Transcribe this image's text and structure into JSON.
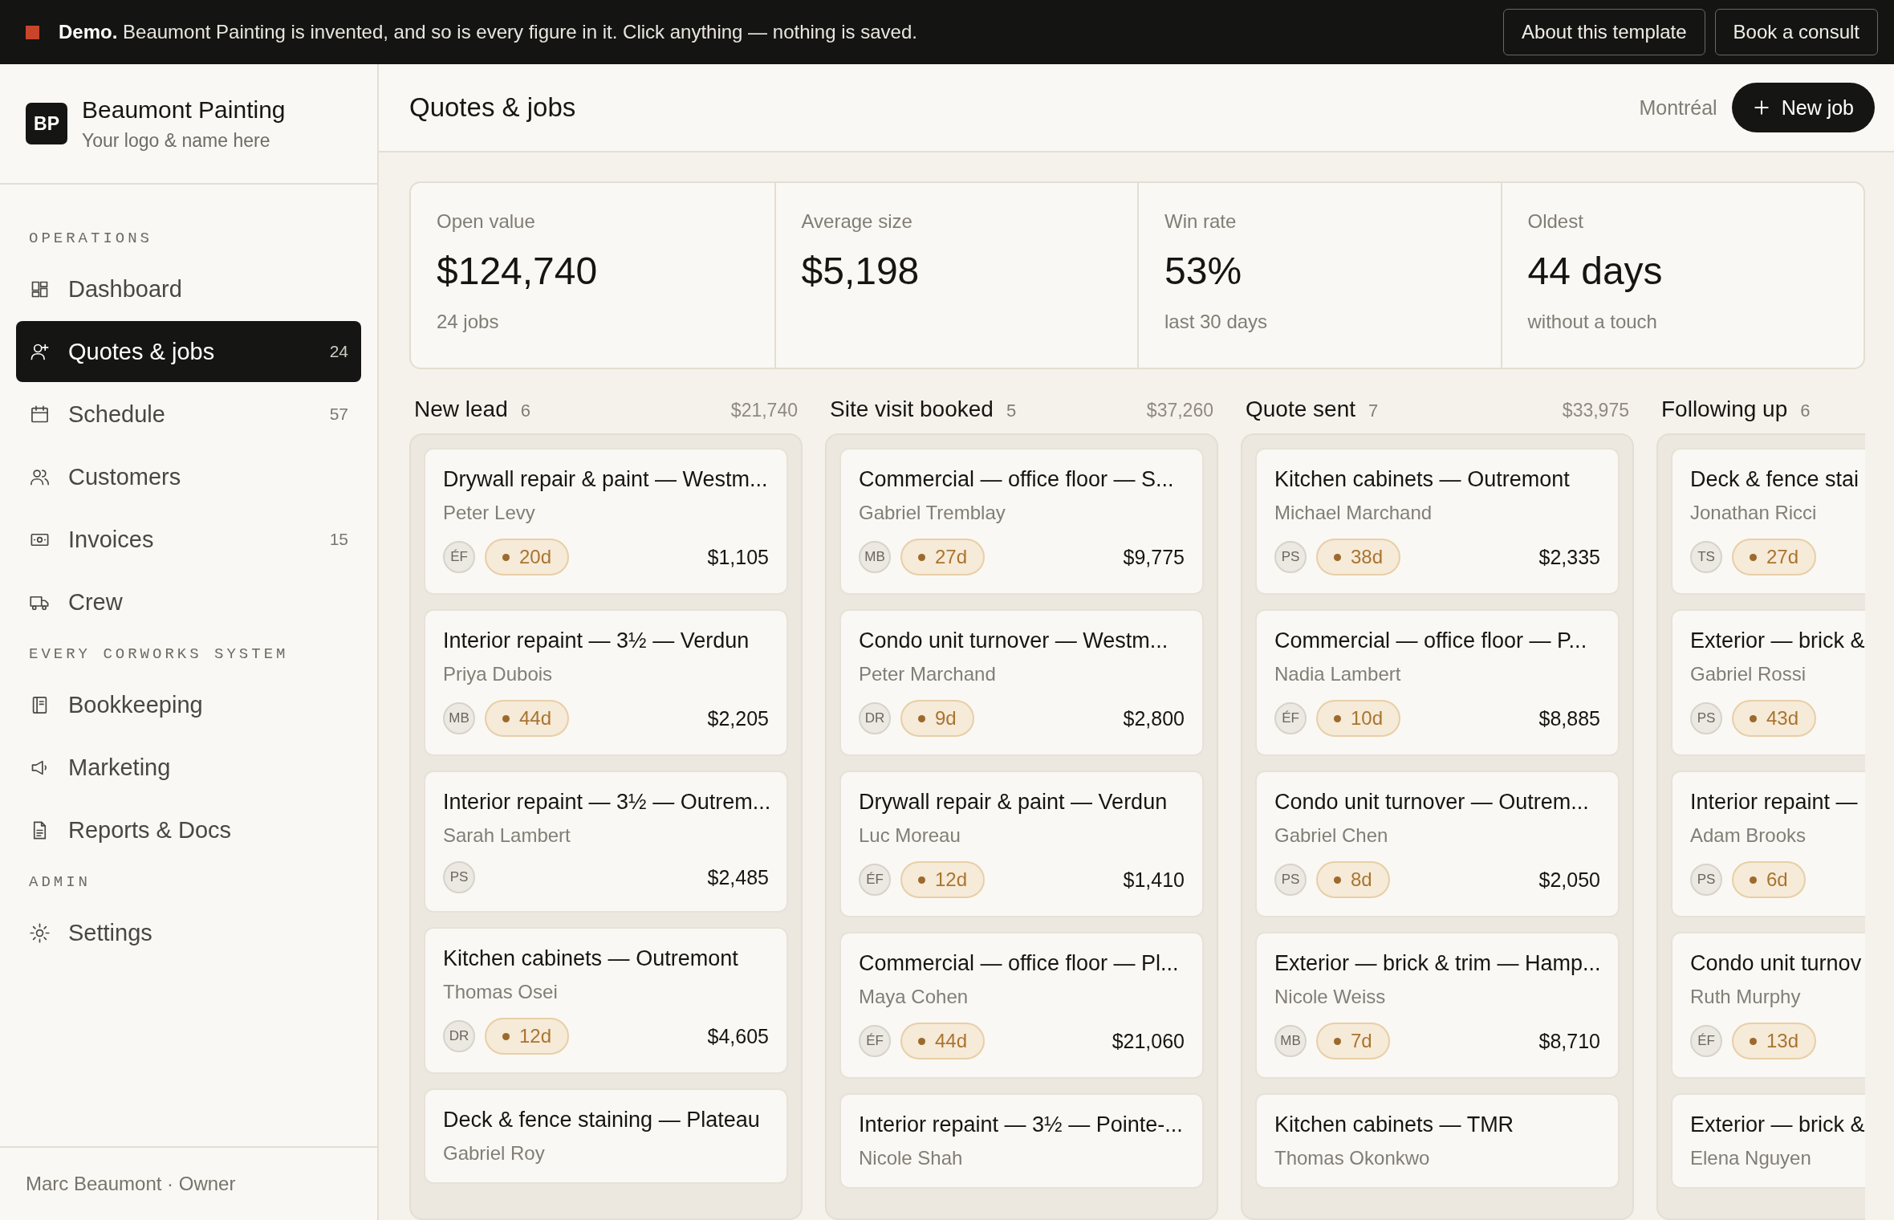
{
  "banner": {
    "text": "**Demo.** Beaumont Painting is invented, and so is every figure in it. Click anything — nothing is saved.",
    "buttons": [
      "About this template",
      "Book a consult"
    ]
  },
  "brand": {
    "initials": "BP",
    "name": "Beaumont Painting",
    "tagline": "Your logo & name here"
  },
  "nav": [
    {
      "heading": "OPERATIONS",
      "items": [
        {
          "label": "Dashboard",
          "selected": false
        },
        {
          "label": "Quotes & jobs",
          "count": "24",
          "selected": true
        },
        {
          "label": "Schedule",
          "count": "57",
          "selected": false
        },
        {
          "label": "Customers",
          "selected": false
        },
        {
          "label": "Invoices",
          "count": "15",
          "selected": false
        },
        {
          "label": "Crew",
          "selected": false
        }
      ]
    },
    {
      "heading": "EVERY CORWORKS SYSTEM",
      "items": [
        {
          "label": "Bookkeeping",
          "selected": false
        },
        {
          "label": "Marketing",
          "selected": false
        },
        {
          "label": "Reports & Docs",
          "selected": false
        }
      ]
    },
    {
      "heading": "ADMIN",
      "items": [
        {
          "label": "Settings",
          "selected": false
        }
      ]
    }
  ],
  "user": "Marc Beaumont · Owner",
  "header": {
    "title": "Quotes & jobs",
    "location": "Montréal",
    "new_button": "New job"
  },
  "stats": [
    {
      "label": "Open value",
      "value": "$124,740",
      "note": "24 jobs"
    },
    {
      "label": "Average size",
      "value": "$5,198"
    },
    {
      "label": "Win rate",
      "value": "53%",
      "note": "last 30 days"
    },
    {
      "label": "Oldest",
      "value": "44 days",
      "note": "without a touch"
    }
  ],
  "columns": [
    {
      "title": "New lead",
      "count": "6",
      "total": "$21,740",
      "cards": [
        {
          "title": "Drywall repair & paint — Westm...",
          "client": "Peter Levy",
          "initials": "ÉF",
          "age": "20d",
          "amount": "$1,105"
        },
        {
          "title": "Interior repaint — 3½ — Verdun",
          "client": "Priya Dubois",
          "initials": "MB",
          "age": "44d",
          "amount": "$2,205"
        },
        {
          "title": "Interior repaint — 3½ — Outrem...",
          "client": "Sarah Lambert",
          "initials": "PS",
          "amount": "$2,485"
        },
        {
          "title": "Kitchen cabinets — Outremont",
          "client": "Thomas Osei",
          "initials": "DR",
          "age": "12d",
          "amount": "$4,605"
        },
        {
          "title": "Deck & fence staining — Plateau",
          "client": "Gabriel Roy"
        }
      ]
    },
    {
      "title": "Site visit booked",
      "count": "5",
      "total": "$37,260",
      "cards": [
        {
          "title": "Commercial — office floor — S...",
          "client": "Gabriel Tremblay",
          "initials": "MB",
          "age": "27d",
          "amount": "$9,775"
        },
        {
          "title": "Condo unit turnover — Westm...",
          "client": "Peter Marchand",
          "initials": "DR",
          "age": "9d",
          "amount": "$2,800"
        },
        {
          "title": "Drywall repair & paint — Verdun",
          "client": "Luc Moreau",
          "initials": "ÉF",
          "age": "12d",
          "amount": "$1,410"
        },
        {
          "title": "Commercial — office floor — Pl...",
          "client": "Maya Cohen",
          "initials": "ÉF",
          "age": "44d",
          "amount": "$21,060"
        },
        {
          "title": "Interior repaint — 3½ — Pointe-...",
          "client": "Nicole Shah"
        }
      ]
    },
    {
      "title": "Quote sent",
      "count": "7",
      "total": "$33,975",
      "cards": [
        {
          "title": "Kitchen cabinets — Outremont",
          "client": "Michael Marchand",
          "initials": "PS",
          "age": "38d",
          "amount": "$2,335"
        },
        {
          "title": "Commercial — office floor — P...",
          "client": "Nadia Lambert",
          "initials": "ÉF",
          "age": "10d",
          "amount": "$8,885"
        },
        {
          "title": "Condo unit turnover — Outrem...",
          "client": "Gabriel Chen",
          "initials": "PS",
          "age": "8d",
          "amount": "$2,050"
        },
        {
          "title": "Exterior — brick & trim — Hamp...",
          "client": "Nicole Weiss",
          "initials": "MB",
          "age": "7d",
          "amount": "$8,710"
        },
        {
          "title": "Kitchen cabinets — TMR",
          "client": "Thomas Okonkwo"
        }
      ]
    },
    {
      "title": "Following up",
      "count": "6",
      "cards": [
        {
          "title": "Deck & fence stai",
          "client": "Jonathan Ricci",
          "initials": "TS",
          "age": "27d"
        },
        {
          "title": "Exterior — brick &",
          "client": "Gabriel Rossi",
          "initials": "PS",
          "age": "43d"
        },
        {
          "title": "Interior repaint —",
          "client": "Adam Brooks",
          "initials": "PS",
          "age": "6d"
        },
        {
          "title": "Condo unit turnov",
          "client": "Ruth Murphy",
          "initials": "ÉF",
          "age": "13d"
        },
        {
          "title": "Exterior — brick &",
          "client": "Elena Nguyen"
        }
      ]
    }
  ]
}
